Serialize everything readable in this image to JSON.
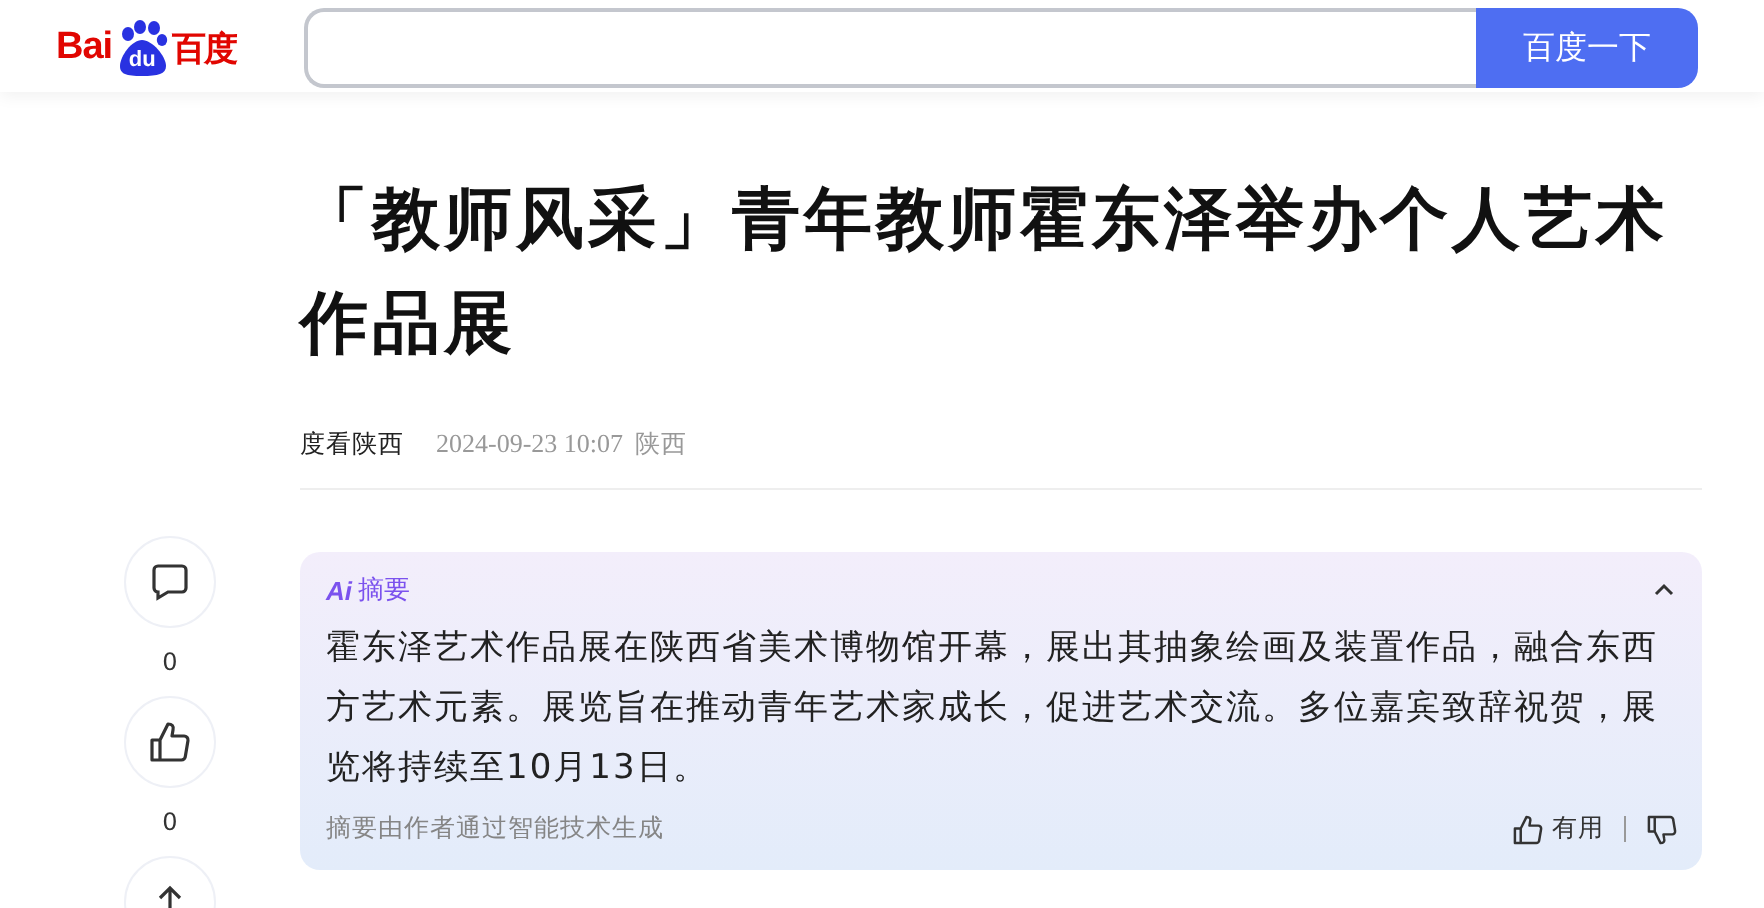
{
  "header": {
    "logo": {
      "prefix": "Bai",
      "paw": "du",
      "suffix": "百度"
    },
    "search": {
      "button": "百度一下"
    }
  },
  "article": {
    "title": "「教师风采」青年教师霍东泽举办个人艺术作品展",
    "author": "度看陕西",
    "date": "2024-09-23 10:07",
    "location": "陕西"
  },
  "actions": [
    {
      "kind": "comment",
      "count": "0"
    },
    {
      "kind": "like",
      "count": "0"
    },
    {
      "kind": "share"
    }
  ],
  "summary": {
    "badge": "Ai",
    "label": "摘要",
    "expanded": true,
    "text": "霍东泽艺术作品展在陕西省美术博物馆开幕，展出其抽象绘画及装置作品，融合东西方艺术元素。展览旨在推动青年艺术家成长，促进艺术交流。多位嘉宾致辞祝贺，展览将持续至10月13日。",
    "note": "摘要由作者通过智能技术生成",
    "useful": "有用"
  }
}
